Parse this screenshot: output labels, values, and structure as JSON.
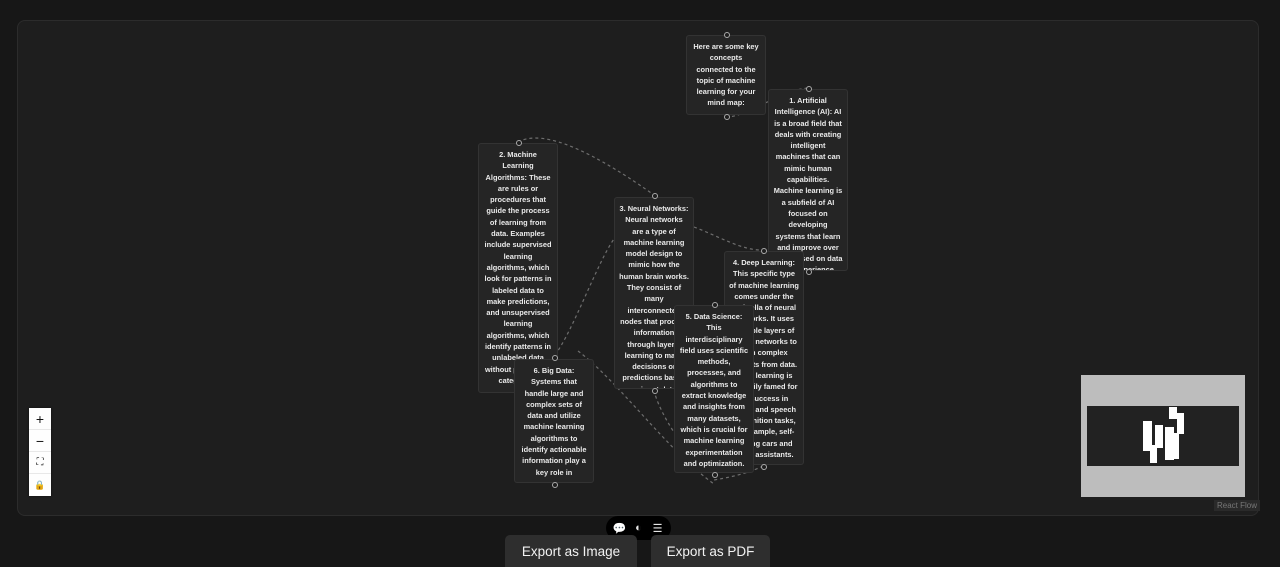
{
  "nodes": [
    {
      "id": "intro",
      "label": "Here are some key concepts connected to the topic of machine learning for your mind map:"
    },
    {
      "id": "n1",
      "label": "1. Artificial Intelligence (AI): AI is a broad field that deals with creating intelligent machines that can mimic human capabilities. Machine learning is a subfield of AI focused on developing systems that learn and improve over time, based on data and experience."
    },
    {
      "id": "n2",
      "label": "2. Machine Learning Algorithms: These are rules or procedures that guide the process of learning from data. Examples include supervised learning algorithms, which look for patterns in labeled data to make predictions, and unsupervised learning algorithms, which identify patterns in unlabeled data without predefined categories."
    },
    {
      "id": "n3",
      "label": "3. Neural Networks: Neural networks are a type of machine learning model design to mimic how the human brain works. They consist of many interconnected nodes that process information through layers, learning to make decisions or predictions based on input data."
    },
    {
      "id": "n4",
      "label": "4. Deep Learning: This specific type of machine learning comes under the umbrella of neural networks. It uses multiple layers of neural networks to gain complex insights from data. Deep learning is primarily famed for its success in image and speech recognition tasks, for example, self-driving cars and voice assistants."
    },
    {
      "id": "n5",
      "label": "5. Data Science: This interdisciplinary field uses scientific methods, processes, and algorithms to extract knowledge and insights from many datasets, which is crucial for machine learning experimentation and optimization."
    },
    {
      "id": "n6",
      "label": "6. Big Data: Systems that handle large and complex sets of data and utilize machine learning algorithms to identify actionable information play a key role in"
    }
  ],
  "controls": {
    "zoom_in": "+",
    "zoom_out": "−",
    "fit_view": "⛶",
    "lock": "🔒"
  },
  "attribution": "React Flow",
  "toolbar": {
    "chat_icon": "💬",
    "toggle_icon": "◐",
    "settings_icon": "☰"
  },
  "buttons": {
    "export_image": "Export as Image",
    "export_pdf": "Export as PDF"
  }
}
